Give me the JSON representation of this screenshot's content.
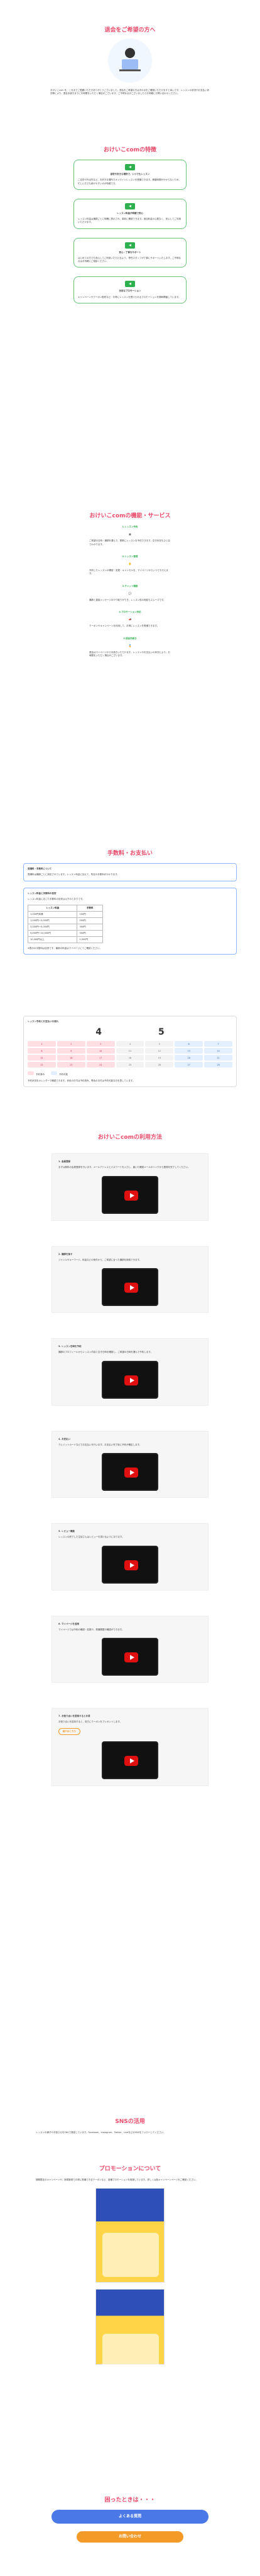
{
  "hero": {
    "title": "退会をご希望の方へ",
    "body": "おけいこcom を、これまでご愛顧いただきありがとうございました。退会をご希望の方は次の点をご確認いただけますと幸いです。レッスンの状況やお支払い状況等により、退会手続きまでにお時間をいただく場合がございます。ご不明な点がございましたらお気軽にお問い合わせください。"
  },
  "features": {
    "title": "おけいこcomの特徴",
    "items": [
      {
        "heading": "自宅や好きな場所で、いつでもレッスン",
        "body": "ご自宅や外出先など、お好きな場所でオンラインレッスンを受講できます。移動時間がかからないため、忙しい方でも続けやすいのが特徴です。"
      },
      {
        "heading": "レッスン料金が明確で安心",
        "body": "レッスン料金は講師ごとに明確に表示され、事前に確認できます。追加料金の心配なく、安心してご利用いただけます。"
      },
      {
        "heading": "安心・丁寧なサポート",
        "body": "はじめての方でも安心してご利用いただけるよう、専任スタッフが丁寧にサポートいたします。ご不明な点はお気軽にご相談ください。"
      },
      {
        "heading": "多彩なプロモーション",
        "body": "キャンペーンやクーポン配布など、お得にレッスンを受けられるプロモーションを随時開催しています。"
      }
    ]
  },
  "services": {
    "title": "おけいこcomの機能・サービス",
    "items": [
      {
        "heading": "1.レッスン予約",
        "body": "ご希望の日時・講師を選んで、簡単にレッスンを予約できます。空き状況もひと目でわかります。"
      },
      {
        "heading": "2.レッスン管理",
        "body": "予約したレッスンの確認・変更・キャンセルを、マイページからいつでも行えます。"
      },
      {
        "heading": "3.チャット機能",
        "body": "講師と直接メッセージのやり取りができ、レッスン前の相談もスムーズです。"
      },
      {
        "heading": "4.プロモーション対応",
        "body": "クーポンやキャンペーンを利用して、お得にレッスンを受講できます。"
      },
      {
        "heading": "5.退会手続き",
        "body": "退会はマイページから手続きいただけます。レッスンやお支払いの状況により、お時間をいただく場合がございます。"
      }
    ]
  },
  "fees": {
    "title": "手数料・お支払い",
    "box1_title": "受講料・手数料について",
    "box1_text": "受講料は講師ごとに設定されています。レッスン料金に加えて、所定の手数料がかかります。",
    "box2_title": "レッスン料金と手数料の目安",
    "box2_text": "レッスン料金に応じた手数料の目安は以下のとおりです。",
    "table": {
      "header": [
        "レッスン料金",
        "手数料"
      ],
      "rows": [
        [
          "1,000円未満",
          "100円"
        ],
        [
          "1,000円〜3,000円",
          "200円"
        ],
        [
          "3,000円〜5,000円",
          "300円"
        ],
        [
          "5,000円〜10,000円",
          "500円"
        ],
        [
          "10,000円以上",
          "1,000円"
        ]
      ]
    },
    "note": "※表示の手数料は目安です。最新の料金はマイページにてご確認ください。"
  },
  "calendar": {
    "title": "レッスン予約とお支払いの流れ",
    "month_a": "4",
    "month_b": "5",
    "desc": "予約状況をカレンダーで確認できます。赤色の日付は予約済み、青色の日付は予約可能な日を表しています。",
    "days": [
      "1",
      "2",
      "3",
      "4",
      "5",
      "6",
      "7",
      "8",
      "9",
      "10",
      "11",
      "12",
      "13",
      "14",
      "15",
      "16",
      "17",
      "18",
      "19",
      "20",
      "21",
      "22",
      "23",
      "24",
      "25",
      "26",
      "27",
      "28"
    ],
    "legend": [
      "予約済み",
      "予約可能"
    ]
  },
  "howto": {
    "title": "おけいこcomの利用方法",
    "steps": [
      {
        "heading": "1. 会員登録",
        "body": "まずは無料の会員登録を行います。メールアドレスとパスワードを入力し、届いた確認メールのリンクから登録を完了してください。"
      },
      {
        "heading": "2. 講師を探す",
        "body": "ジャンルやキーワード、料金などの条件から、ご希望に合った講師を検索できます。"
      },
      {
        "heading": "3. レッスン日時を予約",
        "body": "講師のプロフィールからレッスン内容と空き日時を確認し、ご希望の日時を選んで予約します。"
      },
      {
        "heading": "4. お支払い",
        "body": "クレジットカードなどでお支払いを行います。お支払い完了後に予約が確定します。"
      },
      {
        "heading": "5. レビュー機能",
        "body": "レッスンの終了した生徒さんはレビューを書けるようになります。"
      },
      {
        "heading": "6. マイページを活用",
        "body": "マイページでは予約の確認・変更や、受講履歴の確認ができます。"
      },
      {
        "heading": "7. お知り合いを招待するとお得",
        "body": "お知り合いを招待すると、双方にクーポンをプレゼントします。",
        "badge": "紹介はこちら"
      }
    ]
  },
  "sns": {
    "title": "SNSの活用",
    "body": "レッスンの様子やお知らせをSNSで発信しています。Facebook、Instagram、Twitter、LineなどのSNSをフォローしてください。"
  },
  "promotion": {
    "title": "プロモーションについて",
    "body": "期間限定のキャンペーンや、新規登録でお得に受講できるクーポンなど、各種プロモーションを実施しています。詳しくは各キャンペーンページをご確認ください。"
  },
  "ending": {
    "title": "困ったときは・・・",
    "btn_faq": "よくある質問",
    "btn_contact": "お問い合わせ"
  }
}
